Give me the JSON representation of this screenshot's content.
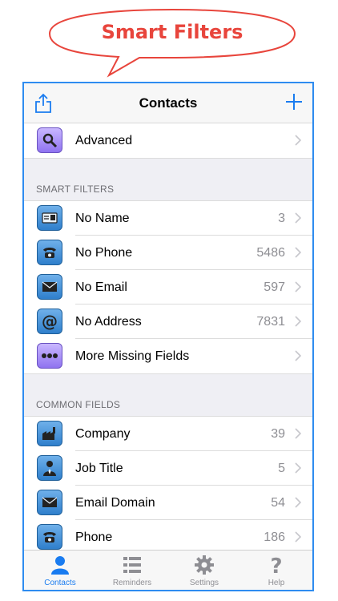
{
  "banner": {
    "title": "Smart Filters"
  },
  "navbar": {
    "title": "Contacts"
  },
  "advanced": {
    "label": "Advanced"
  },
  "smart_filters": {
    "header": "SMART FILTERS",
    "items": [
      {
        "label": "No Name",
        "count": "3",
        "icon": "id-card-icon"
      },
      {
        "label": "No Phone",
        "count": "5486",
        "icon": "phone-icon"
      },
      {
        "label": "No Email",
        "count": "597",
        "icon": "envelope-icon"
      },
      {
        "label": "No Address",
        "count": "7831",
        "icon": "at-sign-icon"
      },
      {
        "label": "More Missing Fields",
        "count": "",
        "icon": "ellipsis-icon"
      }
    ]
  },
  "common_fields": {
    "header": "COMMON FIELDS",
    "items": [
      {
        "label": "Company",
        "count": "39",
        "icon": "factory-icon"
      },
      {
        "label": "Job Title",
        "count": "5",
        "icon": "person-tie-icon"
      },
      {
        "label": "Email Domain",
        "count": "54",
        "icon": "envelope-icon"
      },
      {
        "label": "Phone",
        "count": "186",
        "icon": "phone-icon"
      }
    ]
  },
  "tabbar": {
    "tabs": [
      {
        "label": "Contacts",
        "active": true
      },
      {
        "label": "Reminders",
        "active": false
      },
      {
        "label": "Settings",
        "active": false
      },
      {
        "label": "Help",
        "active": false
      }
    ]
  },
  "colors": {
    "accent": "#1a7cf0",
    "banner": "#e8453c",
    "frame": "#2e8cf0",
    "icon_blue": "#2f7fcc",
    "icon_purple": "#8f73f0"
  }
}
